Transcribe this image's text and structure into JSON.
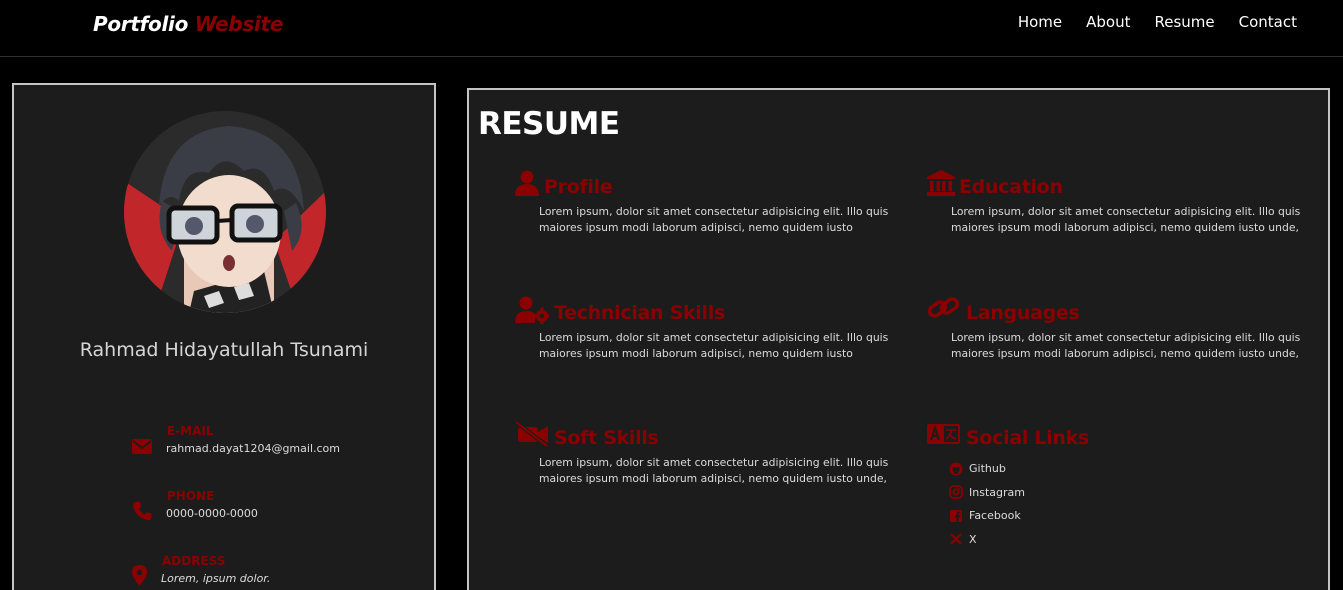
{
  "brand": {
    "part1": "Portfolio",
    "part2": "Website"
  },
  "nav": {
    "items": [
      "Home",
      "About",
      "Resume",
      "Contact"
    ]
  },
  "profile": {
    "name": "Rahmad Hidayatullah Tsunami",
    "contacts": [
      {
        "label": "E-MAIL",
        "value": "rahmad.dayat1204@gmail.com",
        "icon": "mail-icon"
      },
      {
        "label": "PHONE",
        "value": "0000-0000-0000",
        "icon": "phone-icon"
      },
      {
        "label": "ADDRESS",
        "value": "Lorem, ipsum dolor.",
        "icon": "map-pin-icon"
      }
    ]
  },
  "resume": {
    "title": "RESUME",
    "sections": [
      {
        "title": "Profile",
        "icon": "user-icon",
        "text": "Lorem ipsum, dolor sit amet consectetur adipisicing elit. Illo quis maiores ipsum modi laborum adipisci, nemo quidem iusto"
      },
      {
        "title": "Education",
        "icon": "building-columns-icon",
        "text": "Lorem ipsum, dolor sit amet consectetur adipisicing elit. Illo quis maiores ipsum modi laborum adipisci, nemo quidem iusto unde,"
      },
      {
        "title": "Technician Skills",
        "icon": "user-gear-icon",
        "text": "Lorem ipsum, dolor sit amet consectetur adipisicing elit. Illo quis maiores ipsum modi laborum adipisci, nemo quidem iusto"
      },
      {
        "title": "Languages",
        "icon": "link-icon",
        "text": "Lorem ipsum, dolor sit amet consectetur adipisicing elit. Illo quis maiores ipsum modi laborum adipisci, nemo quidem iusto unde,"
      },
      {
        "title": "Soft Skills",
        "icon": "video-slash-icon",
        "text": "Lorem ipsum, dolor sit amet consectetur adipisicing elit. Illo quis maiores ipsum modi laborum adipisci, nemo quidem iusto unde,"
      },
      {
        "title": "Social Links",
        "icon": "translate-icon"
      }
    ],
    "social_links": [
      {
        "label": "Github",
        "icon": "github-icon"
      },
      {
        "label": "Instagram",
        "icon": "instagram-icon"
      },
      {
        "label": "Facebook",
        "icon": "facebook-icon"
      },
      {
        "label": "X",
        "icon": "x-icon"
      }
    ]
  },
  "colors": {
    "accent": "#8b0000",
    "background": "#000000",
    "card": "#1c1c1c",
    "card_border": "#c4c4c4"
  }
}
